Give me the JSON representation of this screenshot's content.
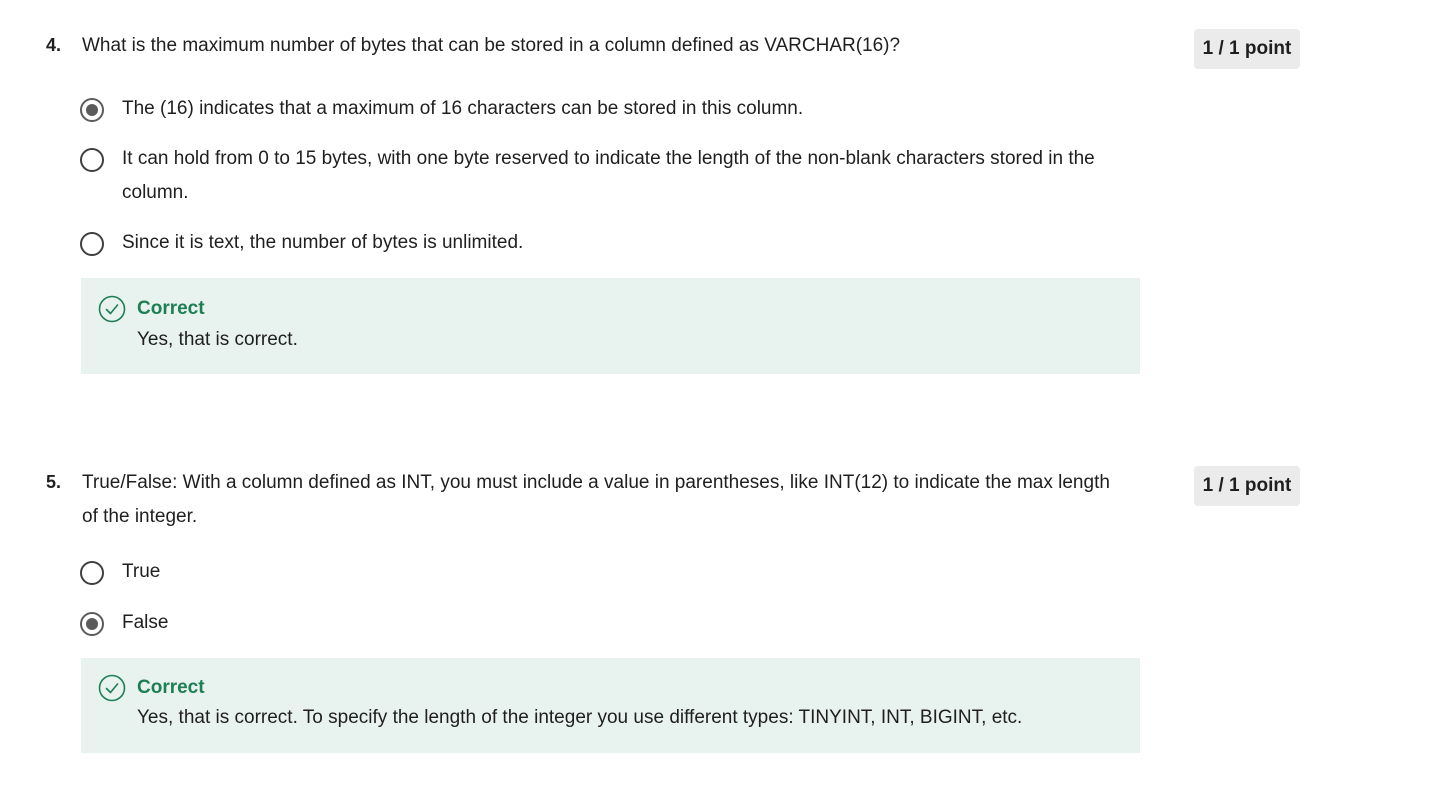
{
  "questions": [
    {
      "number": "4.",
      "text": "What is the maximum number of bytes that can be stored in a column defined as VARCHAR(16)?",
      "points": "1 / 1 point",
      "options": [
        {
          "label": "The (16) indicates that a maximum of 16 characters can be stored in this column.",
          "selected": true
        },
        {
          "label": "It can hold from 0 to 15 bytes, with one byte reserved to indicate the length of the non-blank characters stored in the column.",
          "selected": false
        },
        {
          "label": "Since it is text, the number of bytes is unlimited.",
          "selected": false
        }
      ],
      "feedback": {
        "title": "Correct",
        "text": "Yes, that is correct.",
        "icon": "check-circle-icon"
      }
    },
    {
      "number": "5.",
      "text": "True/False: With a column defined as INT, you must include a value in parentheses, like INT(12) to indicate the max length of the integer.",
      "points": "1 / 1 point",
      "options": [
        {
          "label": "True",
          "selected": false
        },
        {
          "label": "False",
          "selected": true
        }
      ],
      "feedback": {
        "title": "Correct",
        "text": "Yes, that is correct. To specify the length of the integer you use different types: TINYINT, INT, BIGINT, etc.",
        "icon": "check-circle-icon"
      }
    }
  ],
  "colors": {
    "correct": "#1e7e54",
    "feedback_bg": "#e8f2ef",
    "points_bg": "#ebebeb",
    "radio_fill": "#5b5b5b"
  }
}
